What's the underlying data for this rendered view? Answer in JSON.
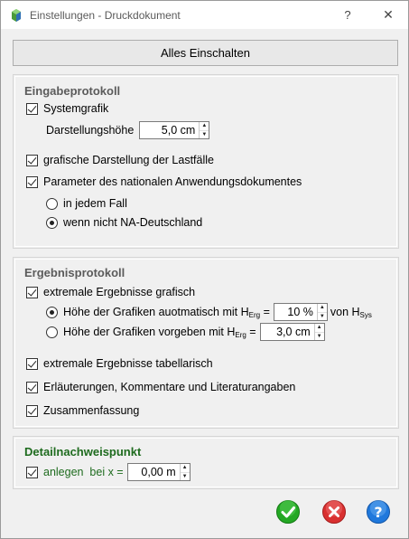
{
  "window": {
    "title": "Einstellungen - Druckdokument",
    "help_glyph": "?",
    "close_glyph": "✕"
  },
  "toolbar": {
    "enable_all_label": "Alles Einschalten"
  },
  "input_protocol": {
    "title": "Eingabeprotokoll",
    "system_graphic": {
      "label": "Systemgrafik",
      "checked": true
    },
    "display_height": {
      "label": "Darstellungshöhe",
      "value": "5,0 cm"
    },
    "load_cases_graphic": {
      "label": "grafische Darstellung der Lastfälle",
      "checked": true
    },
    "national_params": {
      "label": "Parameter des nationalen Anwendungsdokumentes",
      "checked": true
    },
    "radio_always": {
      "label": "in jedem Fall",
      "selected": false
    },
    "radio_not_na_de": {
      "label": "wenn nicht NA-Deutschland",
      "selected": true
    }
  },
  "result_protocol": {
    "title": "Ergebnisprotokoll",
    "extreme_graphic": {
      "label": "extremale Ergebnisse grafisch",
      "checked": true
    },
    "radio_auto_height": {
      "label_prefix": "Höhe der Grafiken auotmatisch mit H",
      "label_sub": "Erg",
      "label_eq": " =",
      "value": "10 %",
      "suffix_prefix": "von H",
      "suffix_sub": "Sys",
      "selected": true
    },
    "radio_fixed_height": {
      "label_prefix": "Höhe der Grafiken vorgeben mit H",
      "label_sub": "Erg",
      "label_eq": " =",
      "value": "3,0 cm",
      "selected": false
    },
    "extreme_table": {
      "label": "extremale Ergebnisse tabellarisch",
      "checked": true
    },
    "explanations": {
      "label": "Erläuterungen, Kommentare und Literaturangaben",
      "checked": true
    },
    "summary": {
      "label": "Zusammenfassung",
      "checked": true
    }
  },
  "detail_point": {
    "title": "Detailnachweispunkt",
    "create_at": {
      "label": "anlegen  bei x =",
      "value": "0,00 m",
      "checked": true
    }
  },
  "colors": {
    "ok": "#1a9a1a",
    "cancel": "#d62b2b",
    "help": "#1a6fd6",
    "detail_title": "#1e6b1e"
  }
}
